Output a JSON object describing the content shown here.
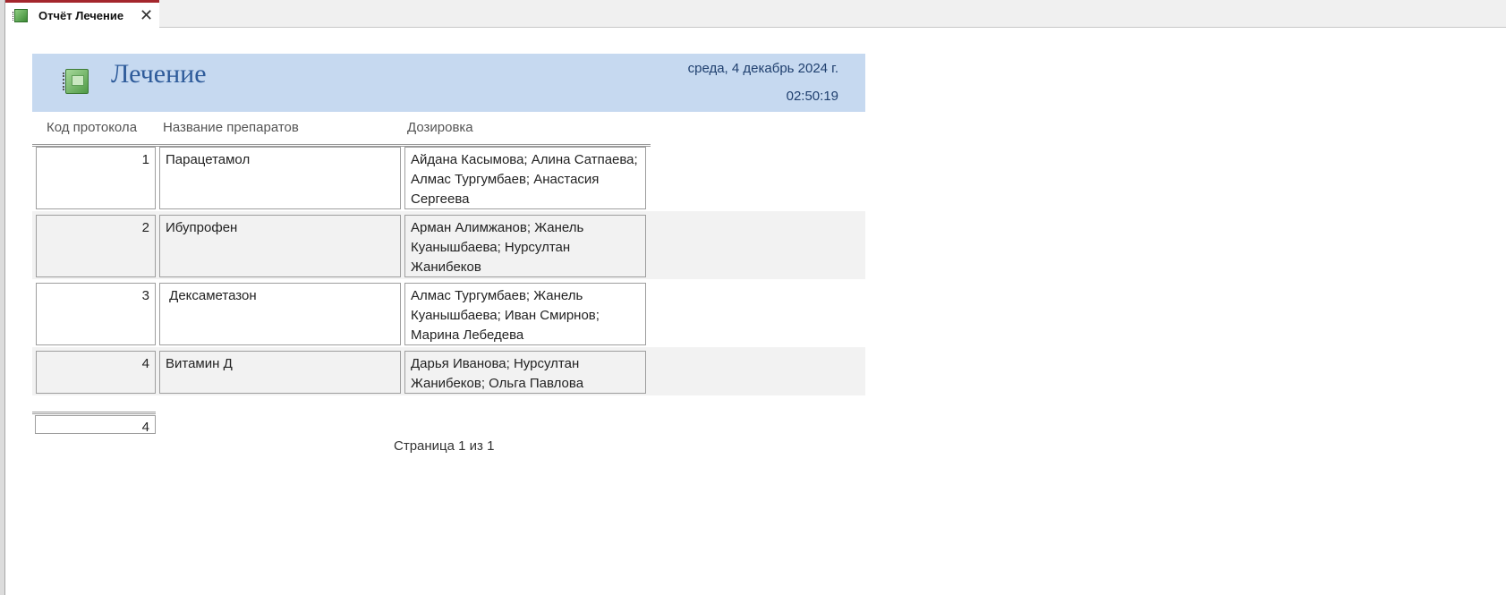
{
  "tab": {
    "title": "Отчёт Лечение",
    "icon": "report-icon",
    "close_icon": "close-icon"
  },
  "report": {
    "title": "Лечение",
    "icon": "notebook-icon",
    "date": "среда, 4 декабрь 2024 г.",
    "time": "02:50:19",
    "columns": [
      "Код протокола",
      "Название препаратов",
      "Дозировка"
    ],
    "rows": [
      {
        "code": "1",
        "name": "Парацетамол",
        "dosage": "Айдана Касымова; Алина Сатпаева; Алмас Тургумбаев; Анастасия Сергеева"
      },
      {
        "code": "2",
        "name": "Ибупрофен",
        "dosage": "Арман Алимжанов; Жанель Куанышбаева; Нурсултан Жанибеков"
      },
      {
        "code": "3",
        "name": " Дексаметазон",
        "dosage": "Алмас Тургумбаев; Жанель Куанышбаева; Иван Смирнов; Марина Лебедева"
      },
      {
        "code": "4",
        "name": "Витамин Д",
        "dosage": "Дарья Иванова; Нурсултан Жанибеков; Ольга Павлова"
      }
    ],
    "total_count": "4",
    "page_footer": "Страница 1 из 1"
  },
  "colors": {
    "header_band": "#c6d9f0",
    "title": "#2e5b9a",
    "tab_accent": "#a4262c",
    "alt_row": "#f2f2f2"
  }
}
